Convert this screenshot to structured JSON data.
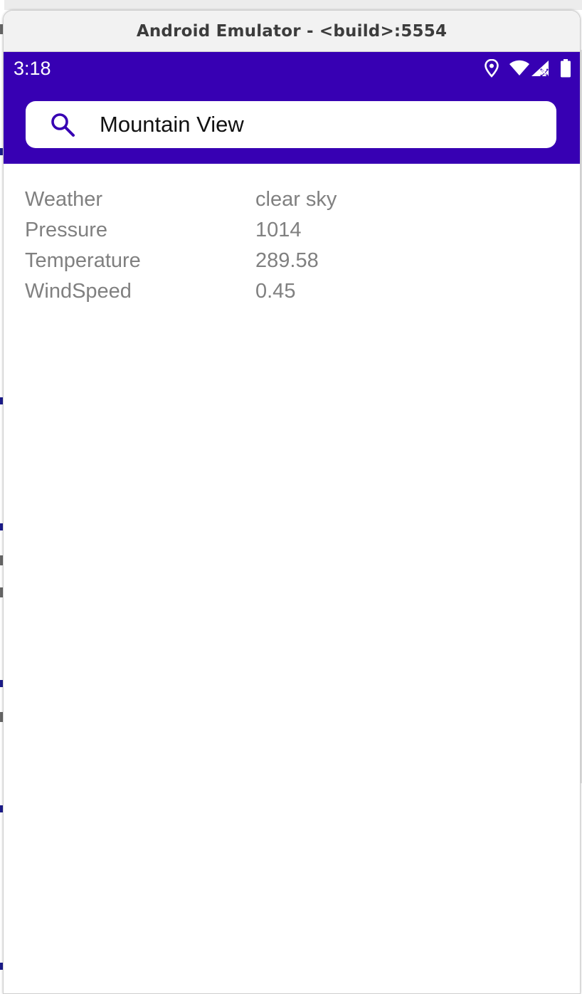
{
  "window": {
    "title": "Android Emulator - <build>:5554"
  },
  "statusbar": {
    "time": "3:18",
    "icons": [
      "location-icon",
      "wifi-icon",
      "cellular-no-data-icon",
      "battery-icon"
    ]
  },
  "search": {
    "icon": "search-icon",
    "value": "Mountain View"
  },
  "weather": {
    "rows": [
      {
        "label": "Weather",
        "value": "clear sky"
      },
      {
        "label": "Pressure",
        "value": "1014"
      },
      {
        "label": "Temperature",
        "value": "289.58"
      },
      {
        "label": "WindSpeed",
        "value": "0.45"
      }
    ]
  },
  "colors": {
    "primary": "#3700b3",
    "search_icon": "#3700b3",
    "label_text": "#808080"
  }
}
